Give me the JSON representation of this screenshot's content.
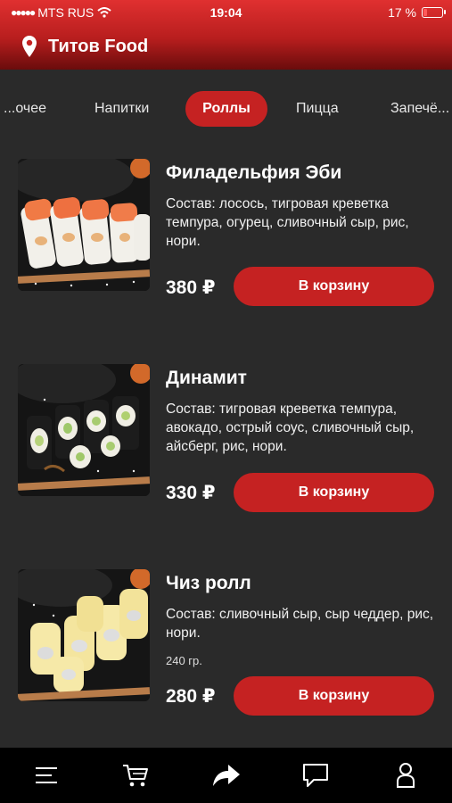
{
  "status_bar": {
    "carrier": "MTS RUS",
    "time": "19:04",
    "battery": "17 %",
    "battery_level": 0.17
  },
  "header": {
    "title": "Титов Food",
    "location_icon": "location-pin-icon"
  },
  "categories": [
    {
      "label": "...очее",
      "active": false
    },
    {
      "label": "Напитки",
      "active": false
    },
    {
      "label": "Роллы",
      "active": true
    },
    {
      "label": "Пицца",
      "active": false
    },
    {
      "label": "Запечё...",
      "active": false
    }
  ],
  "products": [
    {
      "name": "Филадельфия Эби",
      "description": "Состав: лосось, тигровая креветка темпура, огурец, сливочный сыр, рис, нори.",
      "weight": "",
      "price": "380 ₽",
      "button_label": "В корзину"
    },
    {
      "name": "Динамит",
      "description": "Состав: тигровая креветка темпура, авокадо, острый соус, сливочный сыр, айсберг, рис, нори.",
      "weight": "",
      "price": "330 ₽",
      "button_label": "В корзину"
    },
    {
      "name": "Чиз ролл",
      "description": "Состав: сливочный сыр, сыр чеддер, рис, нори.",
      "weight": "240 гр.",
      "price": "280 ₽",
      "button_label": "В корзину"
    }
  ],
  "bottom_nav": [
    {
      "icon": "menu-icon"
    },
    {
      "icon": "cart-icon"
    },
    {
      "icon": "share-arrow-icon"
    },
    {
      "icon": "chat-icon"
    },
    {
      "icon": "profile-icon"
    }
  ],
  "colors": {
    "accent": "#c52222",
    "background": "#2a2a2a",
    "header_top": "#e03030",
    "nav_background": "#000000"
  }
}
